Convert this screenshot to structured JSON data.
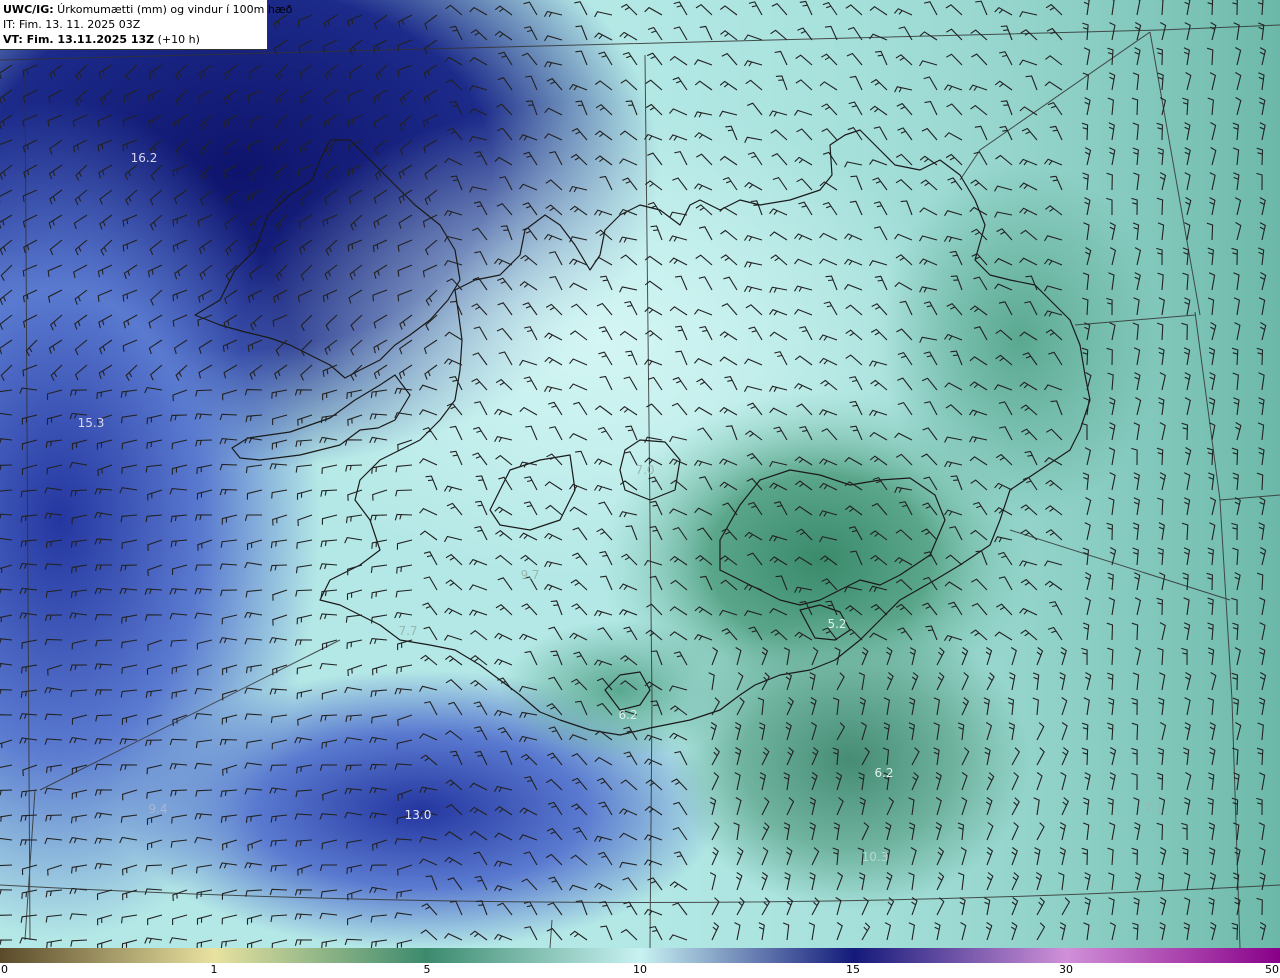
{
  "header": {
    "product": "UWC/IG:",
    "title": " Úrkomumætti (mm) og vindur í 100m hæð",
    "it": "IT: Fim. 13. 11. 2025 03Z",
    "vt_label": "VT:",
    "vt_value": " Fim. 13.11.2025 13Z",
    "vt_offset": " (+10 h)"
  },
  "colorbar": {
    "ticks": [
      "0",
      "1",
      "5",
      "10",
      "15",
      "30",
      "50"
    ],
    "colors": {
      "c0": "#5a4a2a",
      "c1": "#e8e2a0",
      "c5": "#3c8a6e",
      "c10": "#c8f2f2",
      "c15": "#141a7a",
      "c30": "#d090d8",
      "c50": "#880088"
    }
  },
  "map_values": [
    {
      "text": "16.2",
      "style": "light"
    },
    {
      "text": "15.3",
      "style": "light"
    },
    {
      "text": "7.0",
      "style": "dim"
    },
    {
      "text": "9.7",
      "style": "dim"
    },
    {
      "text": "7.7",
      "style": "dim"
    },
    {
      "text": "5.2",
      "style": "light"
    },
    {
      "text": "6.2",
      "style": "light"
    },
    {
      "text": "6.2",
      "style": "light"
    },
    {
      "text": "13.0",
      "style": "light"
    },
    {
      "text": "7.1",
      "style": "dim"
    },
    {
      "text": "9.4",
      "style": "dim"
    },
    {
      "text": "10.3",
      "style": "dim"
    }
  ],
  "colors": {
    "deep_blue": "#14187a",
    "mid_blue": "#4a64c0",
    "light_cyan": "#c6f2f2",
    "teal": "#7cc4b4",
    "dark_green": "#3e8a6e",
    "coast": "#1a1a1a",
    "grid": "#333333",
    "barb": "#222222"
  }
}
